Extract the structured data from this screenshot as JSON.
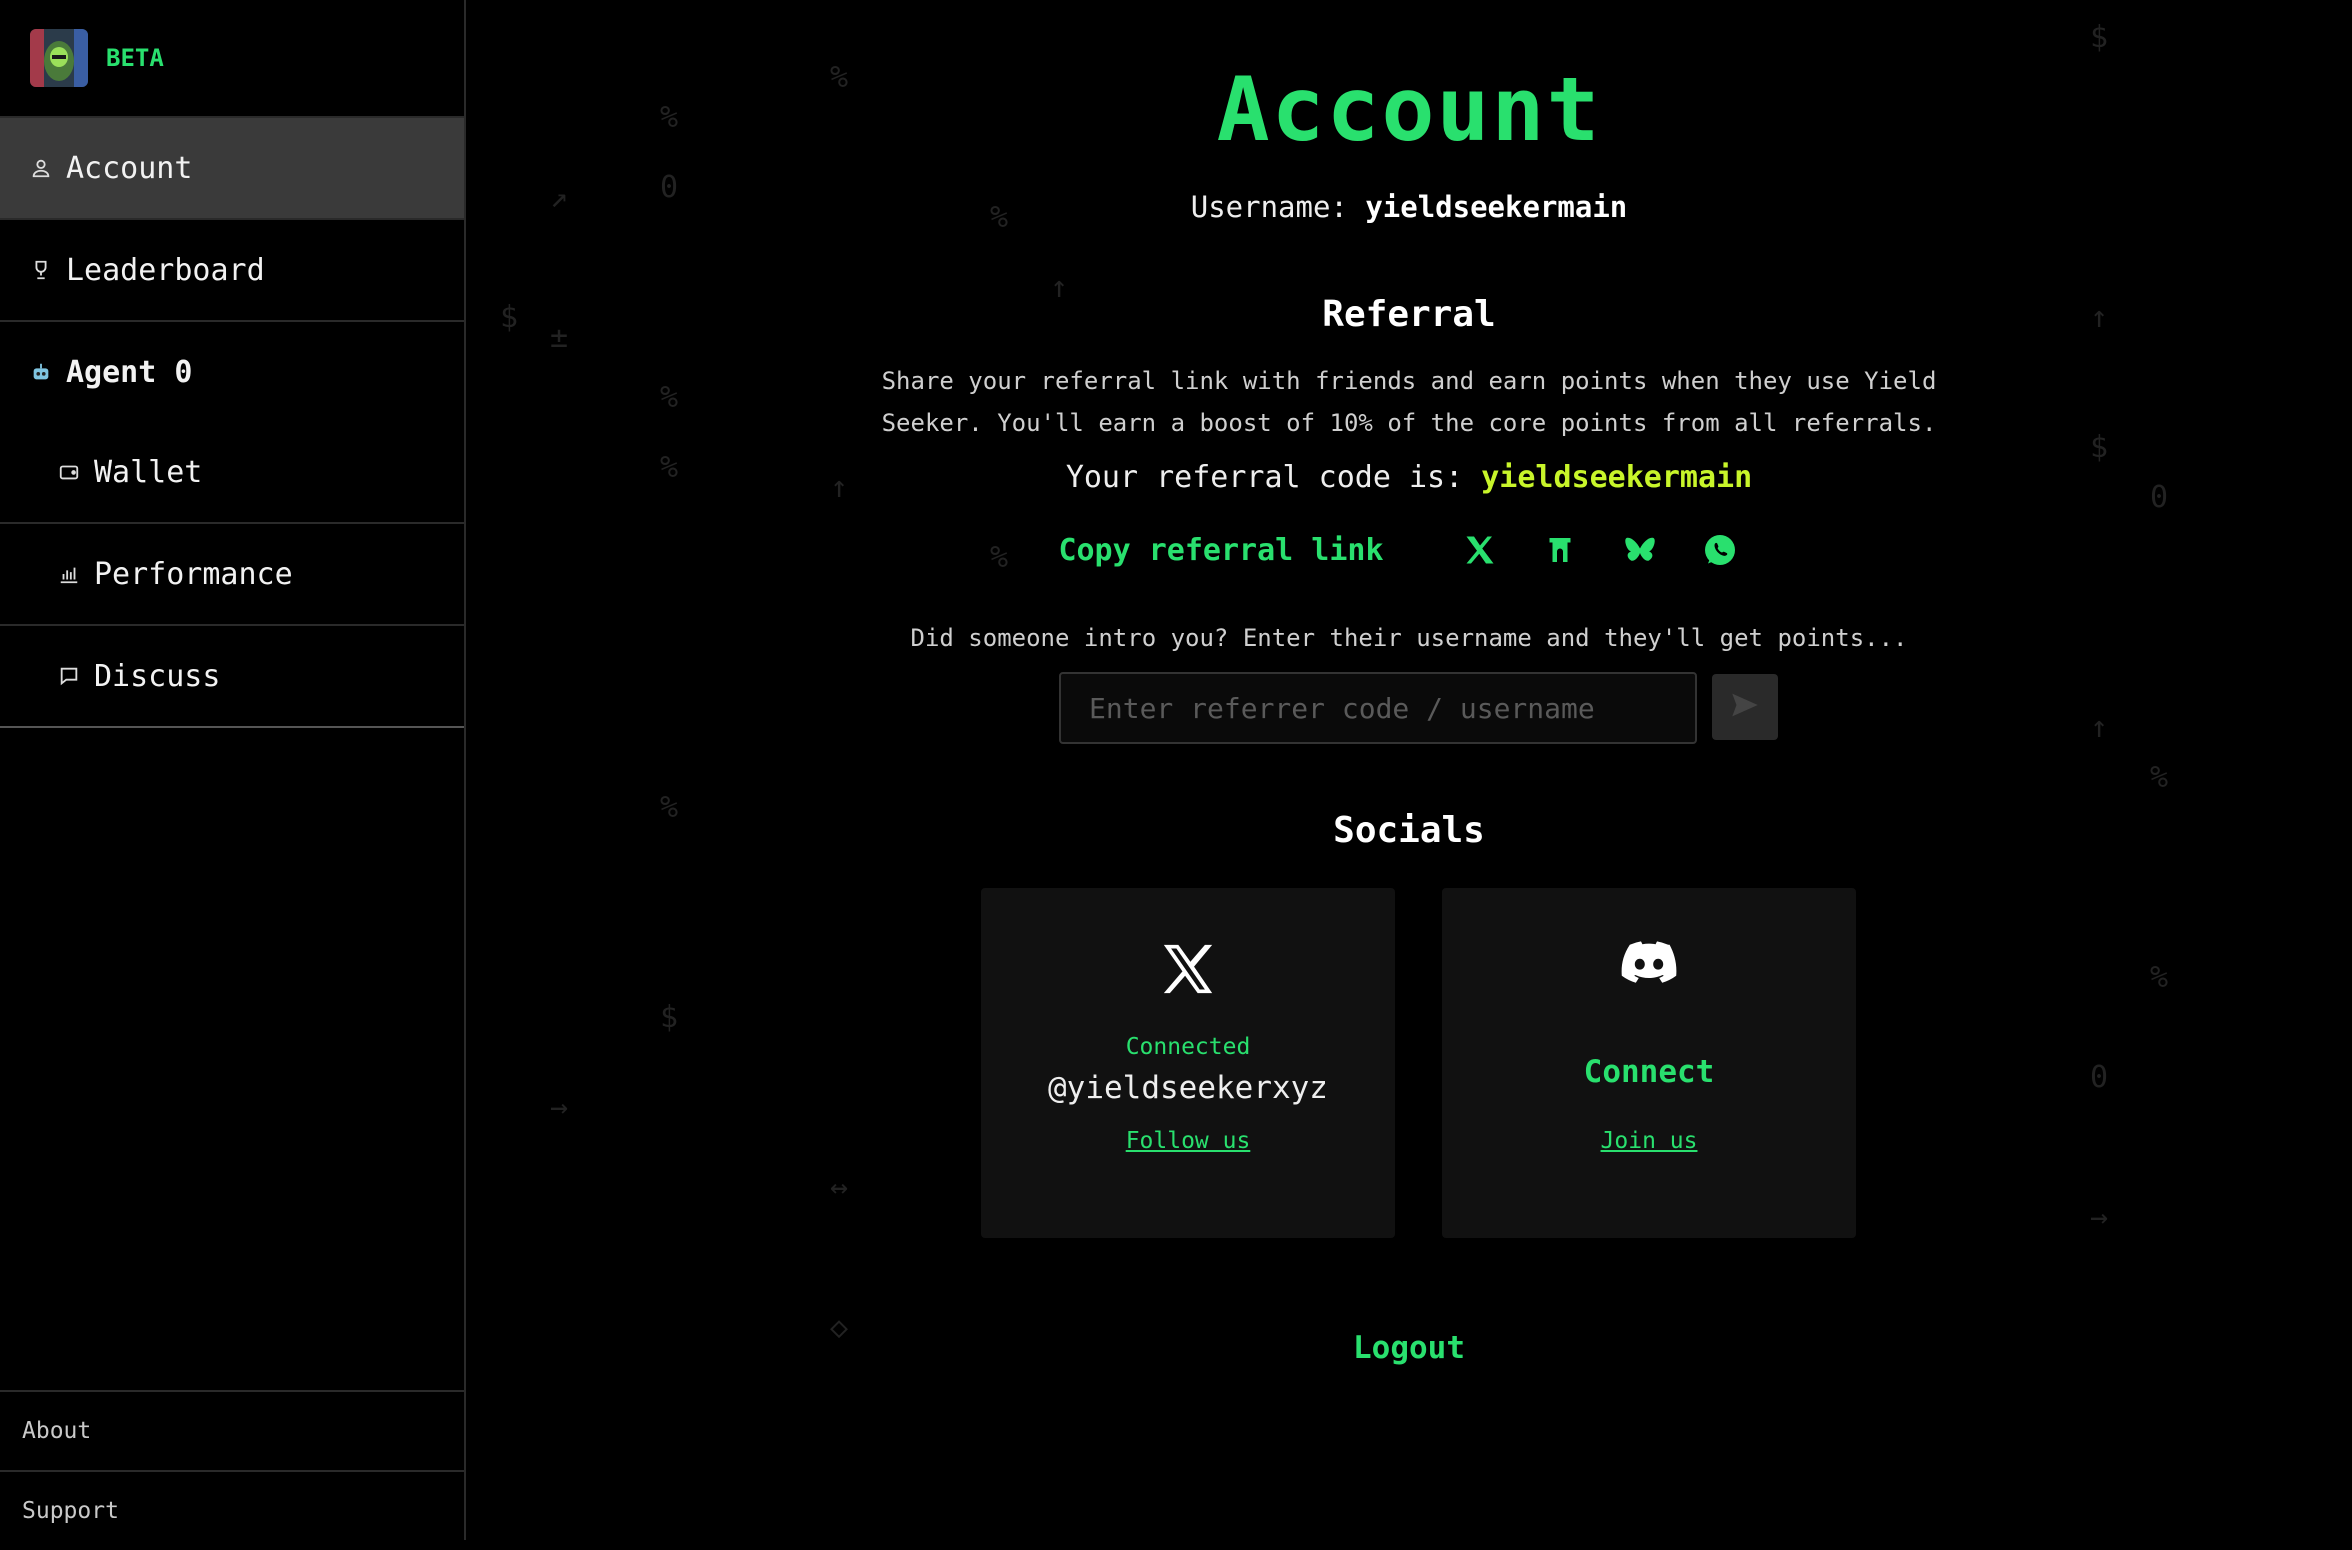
{
  "sidebar": {
    "brand_badge": "BETA",
    "items": [
      {
        "label": "Account",
        "icon": "user-icon",
        "active": true
      },
      {
        "label": "Leaderboard",
        "icon": "trophy-icon"
      },
      {
        "label": "Agent 0",
        "icon": "robot-icon"
      },
      {
        "label": "Wallet",
        "icon": "wallet-icon"
      },
      {
        "label": "Performance",
        "icon": "bar-chart-icon"
      },
      {
        "label": "Discuss",
        "icon": "chat-icon"
      }
    ],
    "footer": [
      {
        "label": "About"
      },
      {
        "label": "Support"
      }
    ]
  },
  "main": {
    "title": "Account",
    "username_prefix": "Username:",
    "username": "yieldseekermain",
    "referral": {
      "heading": "Referral",
      "description": "Share your referral link with friends and earn points when they use Yield Seeker. You'll earn a boost of 10% of the core points from all referrals.",
      "code_prefix": "Your referral code is:",
      "code": "yieldseekermain",
      "copy_label": "Copy referral link",
      "share_icons": [
        "x-icon",
        "farcaster-icon",
        "bluesky-icon",
        "whatsapp-icon"
      ],
      "intro_text": "Did someone intro you? Enter their username and they'll get points...",
      "input_placeholder": "Enter referrer code / username"
    },
    "socials": {
      "heading": "Socials",
      "x": {
        "status": "Connected",
        "handle": "@yieldseekerxyz",
        "link": "Follow us"
      },
      "discord": {
        "connect": "Connect",
        "link": "Join us"
      }
    },
    "logout": "Logout"
  },
  "colors": {
    "accent": "#29e06e",
    "code": "#c8f52a",
    "active_nav": "#3a3a3a"
  }
}
